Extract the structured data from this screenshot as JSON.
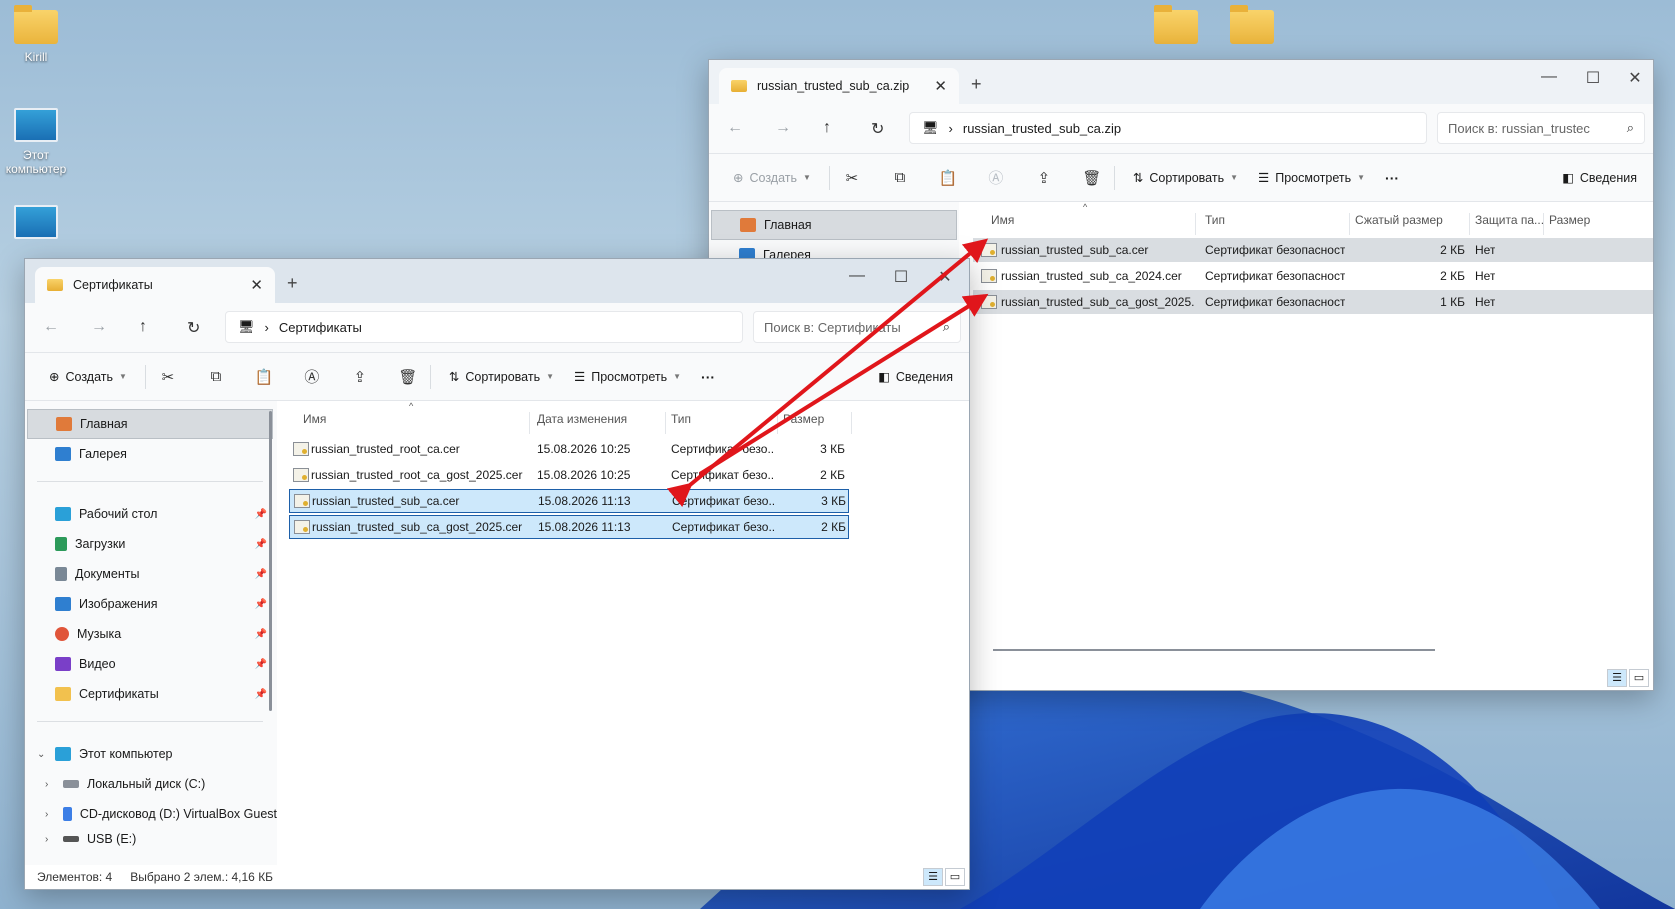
{
  "desktop": {
    "icons": [
      {
        "label": "Kirill",
        "icon": "folder-icon"
      },
      {
        "label": "Этот компьютер",
        "icon": "monitor-icon"
      },
      {
        "label": "",
        "icon": "network-icon"
      },
      {
        "label": "",
        "icon": "folder-icon"
      },
      {
        "label": "",
        "icon": "folder-icon"
      }
    ]
  },
  "zip_window": {
    "tab_title": "russian_trusted_sub_ca.zip",
    "address": "russian_trusted_sub_ca.zip",
    "search_placeholder": "Поиск в: russian_trustec",
    "toolbar": {
      "create": "Создать",
      "sort": "Сортировать",
      "view": "Просмотреть",
      "more": "···",
      "details": "Сведения"
    },
    "nav": {
      "home": "Главная",
      "gallery": "Галерея"
    },
    "columns": {
      "name": "Имя",
      "type": "Тип",
      "compressed": "Сжатый размер",
      "protection": "Защита па...",
      "size": "Размер"
    },
    "files": [
      {
        "name": "russian_trusted_sub_ca.cer",
        "type": "Сертификат безопасности",
        "compressed": "2 КБ",
        "protection": "Нет"
      },
      {
        "name": "russian_trusted_sub_ca_2024.cer",
        "type": "Сертификат безопасности",
        "compressed": "2 КБ",
        "protection": "Нет"
      },
      {
        "name": "russian_trusted_sub_ca_gost_2025....",
        "type": "Сертификат безопасности",
        "compressed": "1 КБ",
        "protection": "Нет"
      }
    ]
  },
  "certs_window": {
    "tab_title": "Сертификаты",
    "address": "Сертификаты",
    "search_placeholder": "Поиск в: Сертификаты",
    "toolbar": {
      "create": "Создать",
      "sort": "Сортировать",
      "view": "Просмотреть",
      "more": "···",
      "details": "Сведения"
    },
    "nav": {
      "home": "Главная",
      "gallery": "Галерея",
      "desktop": "Рабочий стол",
      "downloads": "Загрузки",
      "documents": "Документы",
      "pictures": "Изображения",
      "music": "Музыка",
      "video": "Видео",
      "certs": "Сертификаты",
      "this_pc": "Этот компьютер",
      "disk_c": "Локальный диск (C:)",
      "disk_d": "CD-дисковод (D:) VirtualBox Guest",
      "usb": "USB (E:)"
    },
    "columns": {
      "name": "Имя",
      "modified": "Дата изменения",
      "type": "Тип",
      "size": "Размер"
    },
    "files": [
      {
        "name": "russian_trusted_root_ca.cer",
        "modified": "15.08.2026 10:25",
        "type": "Сертификат безо...",
        "size": "3 КБ"
      },
      {
        "name": "russian_trusted_root_ca_gost_2025.cer",
        "modified": "15.08.2026 10:25",
        "type": "Сертификат безо...",
        "size": "2 КБ"
      },
      {
        "name": "russian_trusted_sub_ca.cer",
        "modified": "15.08.2026 11:13",
        "type": "Сертификат безо...",
        "size": "3 КБ"
      },
      {
        "name": "russian_trusted_sub_ca_gost_2025.cer",
        "modified": "15.08.2026 11:13",
        "type": "Сертификат безо...",
        "size": "2 КБ"
      }
    ],
    "status": {
      "count": "Элементов: 4",
      "selection": "Выбрано 2 элем.: 4,16 КБ"
    }
  },
  "colors": {
    "arrow": "#e0161b",
    "selection": "#cde8fb",
    "selection_border": "#1d5fa8"
  }
}
